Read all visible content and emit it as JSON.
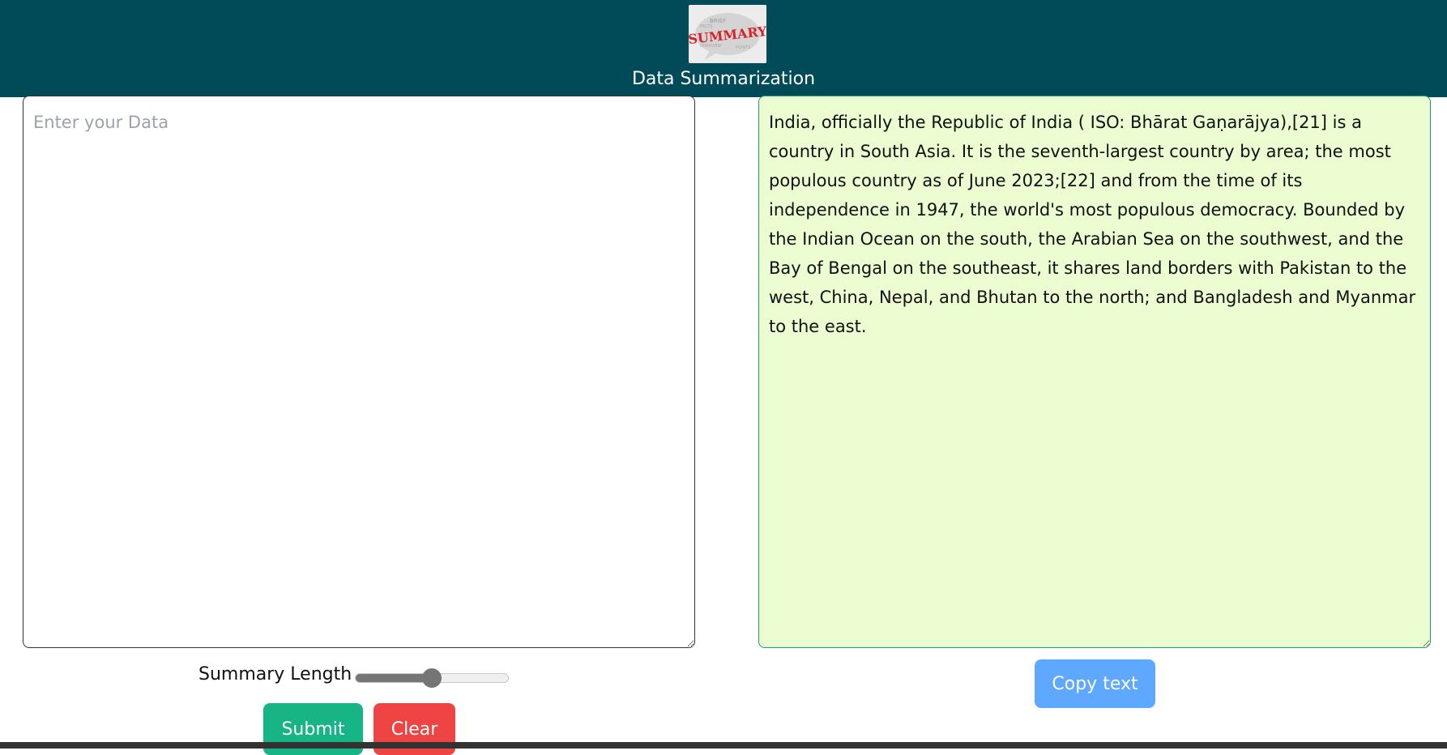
{
  "header": {
    "title": "Data Summarization",
    "logo_text": "SUMMARY"
  },
  "input": {
    "placeholder": "Enter your Data",
    "value": ""
  },
  "output": {
    "value": "India, officially the Republic of India ( ISO: Bhārat Gaṇarājya),[21] is a country in South Asia. It is the seventh-largest country by area; the most populous country as of June 2023;[22] and from the time of its independence in 1947, the world's most populous democracy. Bounded by the Indian Ocean on the south, the Arabian Sea on the southwest, and the Bay of Bengal on the southeast, it shares land borders with Pakistan to the west, China, Nepal, and Bhutan to the north; and Bangladesh and Myanmar to the east."
  },
  "controls": {
    "summary_length_label": "Summary Length",
    "slider_fraction": 0.5,
    "submit_label": "Submit",
    "clear_label": "Clear",
    "copy_label": "Copy text"
  },
  "colors": {
    "header_bg": "#004b57",
    "submit": "#17b485",
    "clear": "#ee4444",
    "copy": "#5fa8ff",
    "output_bg": "#ebfdd1"
  }
}
